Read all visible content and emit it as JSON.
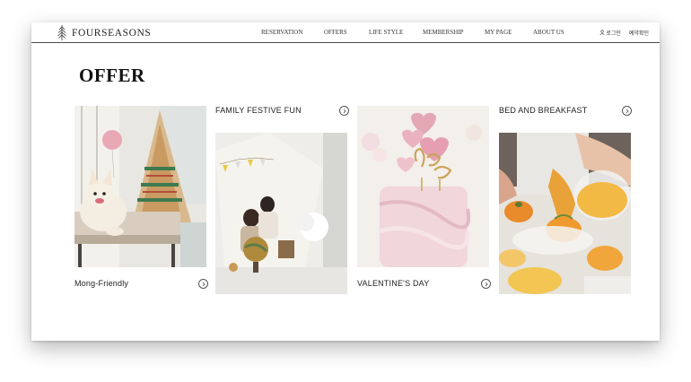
{
  "brand": {
    "name": "FOURSEASONS"
  },
  "nav": {
    "items": [
      "RESERVATION",
      "OFFERS",
      "LIFE STYLE",
      "MEMBERSHIP",
      "MY PAGE",
      "ABOUT US"
    ]
  },
  "utils": {
    "login": "로그인",
    "reservation_check": "예약확인"
  },
  "page": {
    "title": "OFFER"
  },
  "offers": [
    {
      "label": "Mong-Friendly",
      "image": "dog-teepee-photo"
    },
    {
      "label": "FAMILY FESTIVE FUN",
      "image": "family-tent-photo"
    },
    {
      "label": "VALENTINE'S DAY",
      "image": "cake-photo"
    },
    {
      "label": "BED AND BREAKFAST",
      "image": "breakfast-photo"
    }
  ],
  "icons": {
    "arrow": "chevron-right-circle-icon",
    "logo": "tree-logo-icon",
    "user": "user-icon"
  }
}
